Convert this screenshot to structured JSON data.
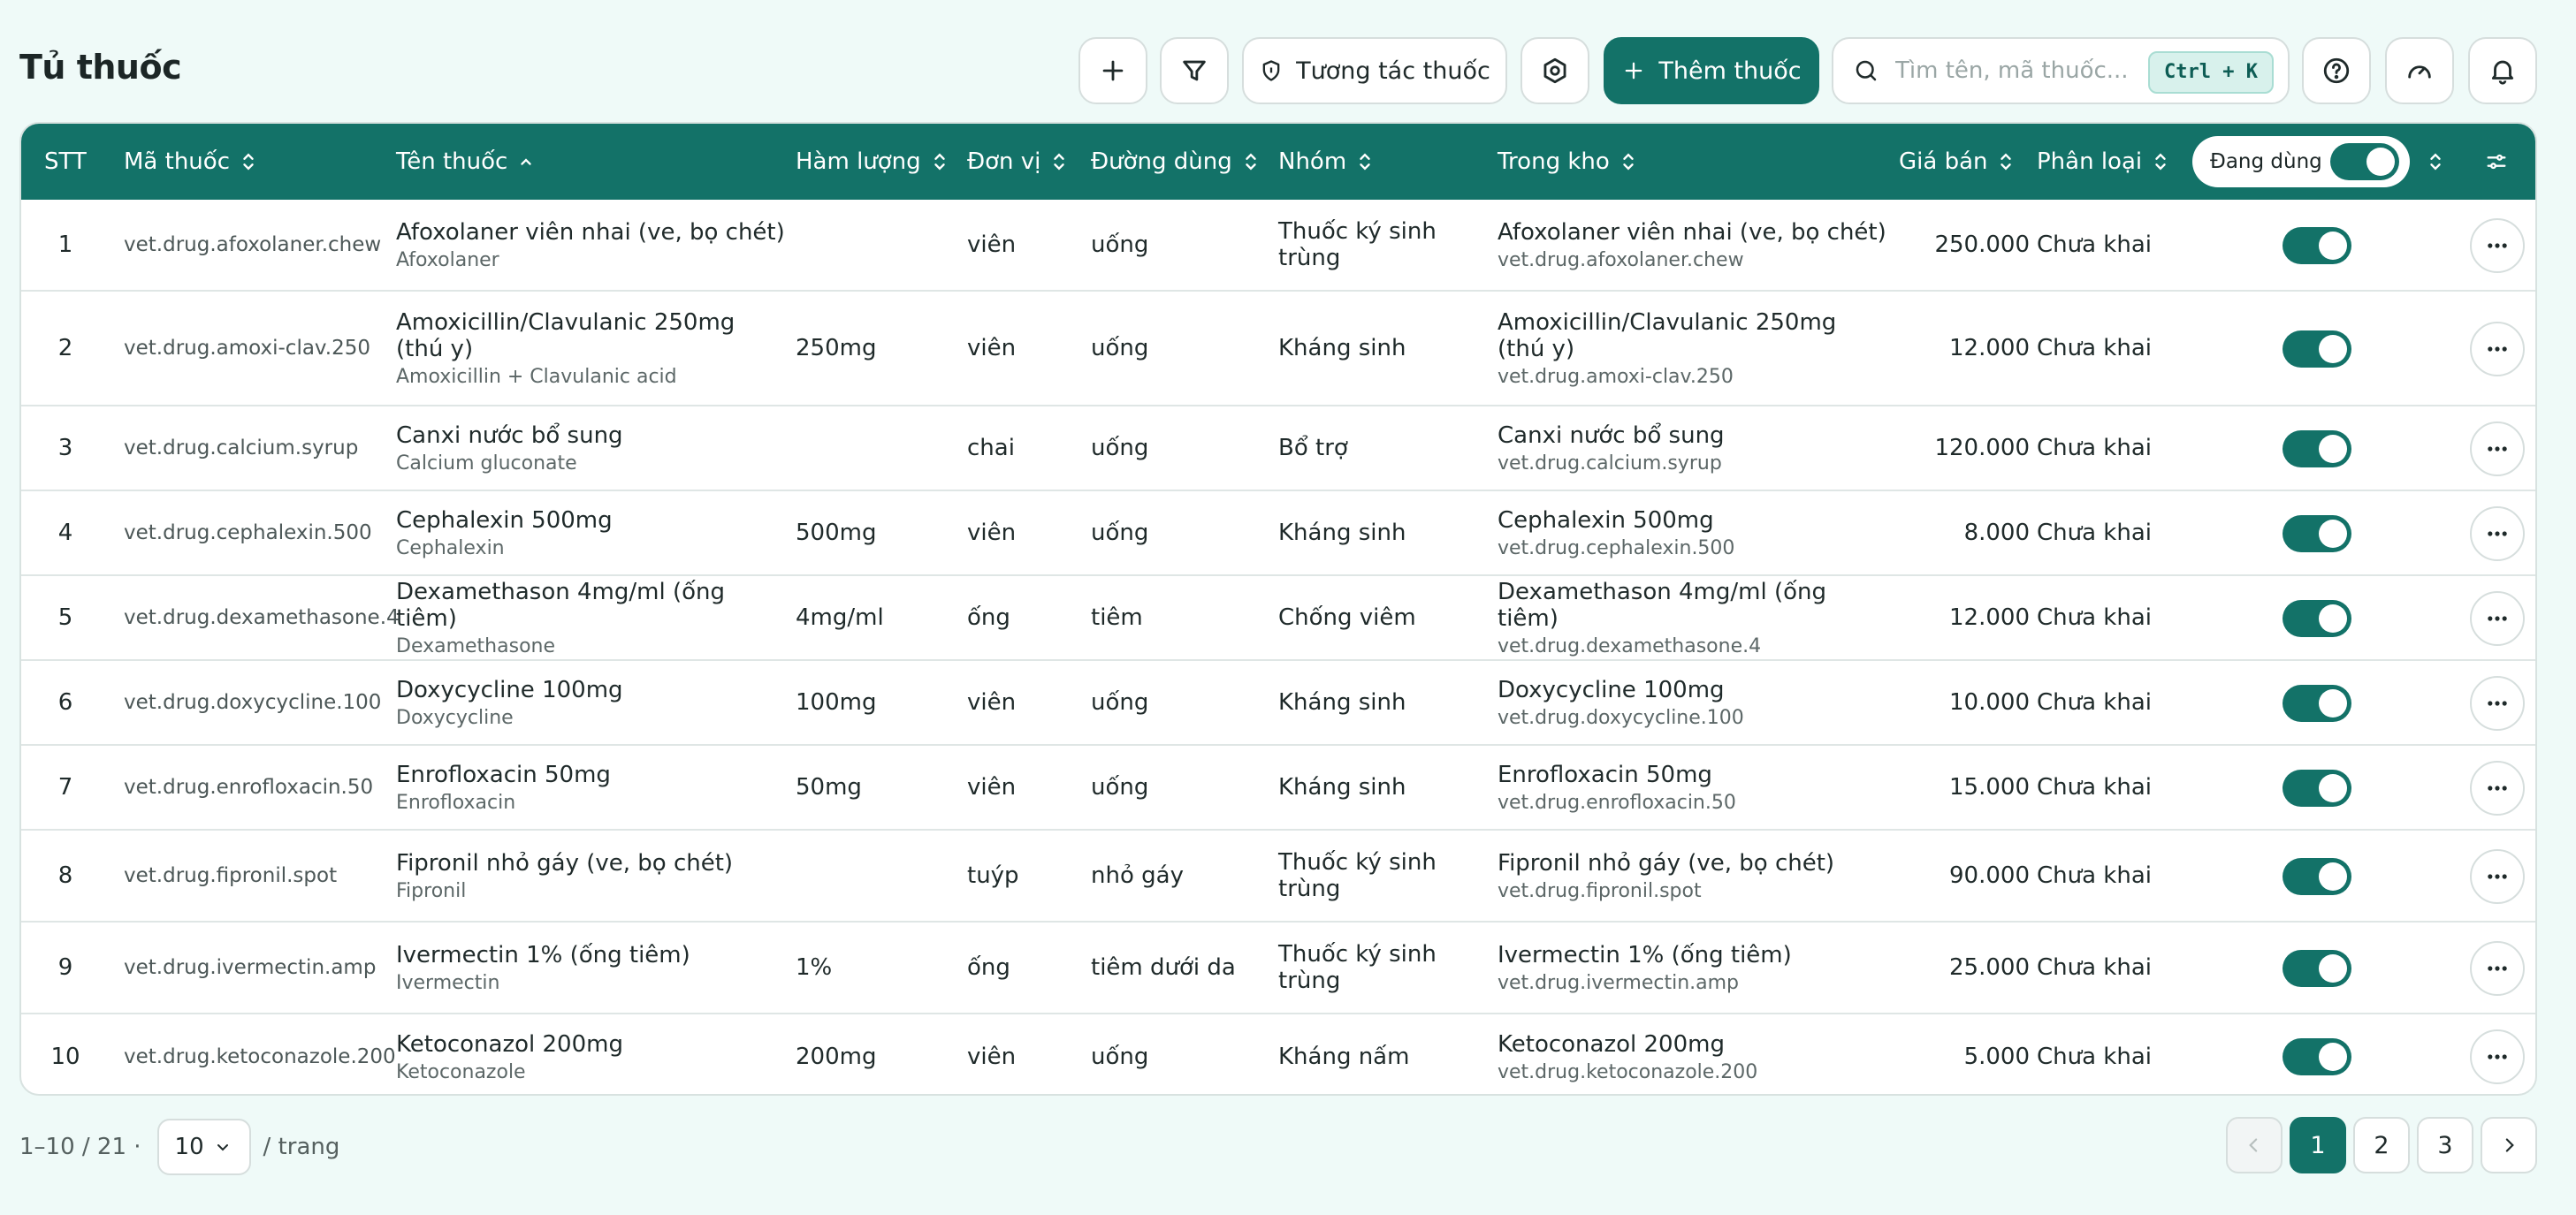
{
  "header": {
    "title": "Tủ thuốc",
    "interaction_label": "Tương tác thuốc",
    "add_drug_label": "Thêm thuốc",
    "search_placeholder": "Tìm tên, mã thuốc...",
    "shortcut": "Ctrl + K"
  },
  "table": {
    "columns": {
      "stt": "STT",
      "code": "Mã thuốc",
      "name": "Tên thuốc",
      "strength": "Hàm lượng",
      "unit": "Đơn vị",
      "route": "Đường dùng",
      "group": "Nhóm",
      "stock": "Trong kho",
      "price": "Giá bán",
      "category": "Phân loại",
      "active_filter": "Đang dùng"
    },
    "rows": [
      {
        "stt": "1",
        "code": "vet.drug.afoxolaner.chew",
        "name": "Afoxolaner viên nhai (ve, bọ chét)",
        "ingredient": "Afoxolaner",
        "strength": "",
        "unit": "viên",
        "route": "uống",
        "group": "Thuốc ký sinh trùng",
        "stock_name": "Afoxolaner viên nhai (ve, bọ chét)",
        "stock_code": "vet.drug.afoxolaner.chew",
        "price": "250.000",
        "category": "Chưa khai",
        "active": true
      },
      {
        "stt": "2",
        "code": "vet.drug.amoxi-clav.250",
        "name": "Amoxicillin/Clavulanic 250mg (thú y)",
        "ingredient": "Amoxicillin + Clavulanic acid",
        "strength": "250mg",
        "unit": "viên",
        "route": "uống",
        "group": "Kháng sinh",
        "stock_name": "Amoxicillin/Clavulanic 250mg (thú y)",
        "stock_code": "vet.drug.amoxi-clav.250",
        "price": "12.000",
        "category": "Chưa khai",
        "active": true
      },
      {
        "stt": "3",
        "code": "vet.drug.calcium.syrup",
        "name": "Canxi nước bổ sung",
        "ingredient": "Calcium gluconate",
        "strength": "",
        "unit": "chai",
        "route": "uống",
        "group": "Bổ trợ",
        "stock_name": "Canxi nước bổ sung",
        "stock_code": "vet.drug.calcium.syrup",
        "price": "120.000",
        "category": "Chưa khai",
        "active": true
      },
      {
        "stt": "4",
        "code": "vet.drug.cephalexin.500",
        "name": "Cephalexin 500mg",
        "ingredient": "Cephalexin",
        "strength": "500mg",
        "unit": "viên",
        "route": "uống",
        "group": "Kháng sinh",
        "stock_name": "Cephalexin 500mg",
        "stock_code": "vet.drug.cephalexin.500",
        "price": "8.000",
        "category": "Chưa khai",
        "active": true
      },
      {
        "stt": "5",
        "code": "vet.drug.dexamethasone.4",
        "name": "Dexamethason 4mg/ml (ống tiêm)",
        "ingredient": "Dexamethasone",
        "strength": "4mg/ml",
        "unit": "ống",
        "route": "tiêm",
        "group": "Chống viêm",
        "stock_name": "Dexamethason 4mg/ml (ống tiêm)",
        "stock_code": "vet.drug.dexamethasone.4",
        "price": "12.000",
        "category": "Chưa khai",
        "active": true
      },
      {
        "stt": "6",
        "code": "vet.drug.doxycycline.100",
        "name": "Doxycycline 100mg",
        "ingredient": "Doxycycline",
        "strength": "100mg",
        "unit": "viên",
        "route": "uống",
        "group": "Kháng sinh",
        "stock_name": "Doxycycline 100mg",
        "stock_code": "vet.drug.doxycycline.100",
        "price": "10.000",
        "category": "Chưa khai",
        "active": true
      },
      {
        "stt": "7",
        "code": "vet.drug.enrofloxacin.50",
        "name": "Enrofloxacin 50mg",
        "ingredient": "Enrofloxacin",
        "strength": "50mg",
        "unit": "viên",
        "route": "uống",
        "group": "Kháng sinh",
        "stock_name": "Enrofloxacin 50mg",
        "stock_code": "vet.drug.enrofloxacin.50",
        "price": "15.000",
        "category": "Chưa khai",
        "active": true
      },
      {
        "stt": "8",
        "code": "vet.drug.fipronil.spot",
        "name": "Fipronil nhỏ gáy (ve, bọ chét)",
        "ingredient": "Fipronil",
        "strength": "",
        "unit": "tuýp",
        "route": "nhỏ gáy",
        "group": "Thuốc ký sinh trùng",
        "stock_name": "Fipronil nhỏ gáy (ve, bọ chét)",
        "stock_code": "vet.drug.fipronil.spot",
        "price": "90.000",
        "category": "Chưa khai",
        "active": true
      },
      {
        "stt": "9",
        "code": "vet.drug.ivermectin.amp",
        "name": "Ivermectin 1% (ống tiêm)",
        "ingredient": "Ivermectin",
        "strength": "1%",
        "unit": "ống",
        "route": "tiêm dưới da",
        "group": "Thuốc ký sinh trùng",
        "stock_name": "Ivermectin 1% (ống tiêm)",
        "stock_code": "vet.drug.ivermectin.amp",
        "price": "25.000",
        "category": "Chưa khai",
        "active": true
      },
      {
        "stt": "10",
        "code": "vet.drug.ketoconazole.200",
        "name": "Ketoconazol 200mg",
        "ingredient": "Ketoconazole",
        "strength": "200mg",
        "unit": "viên",
        "route": "uống",
        "group": "Kháng nấm",
        "stock_name": "Ketoconazol 200mg",
        "stock_code": "vet.drug.ketoconazole.200",
        "price": "5.000",
        "category": "Chưa khai",
        "active": true
      }
    ]
  },
  "footer": {
    "range": "1–10 / 21 ·",
    "per_page": "10",
    "per_page_suffix": "/ trang",
    "pages": [
      "1",
      "2",
      "3"
    ],
    "current_page": "1"
  },
  "colors": {
    "accent": "#137268",
    "background": "#effaf8"
  }
}
